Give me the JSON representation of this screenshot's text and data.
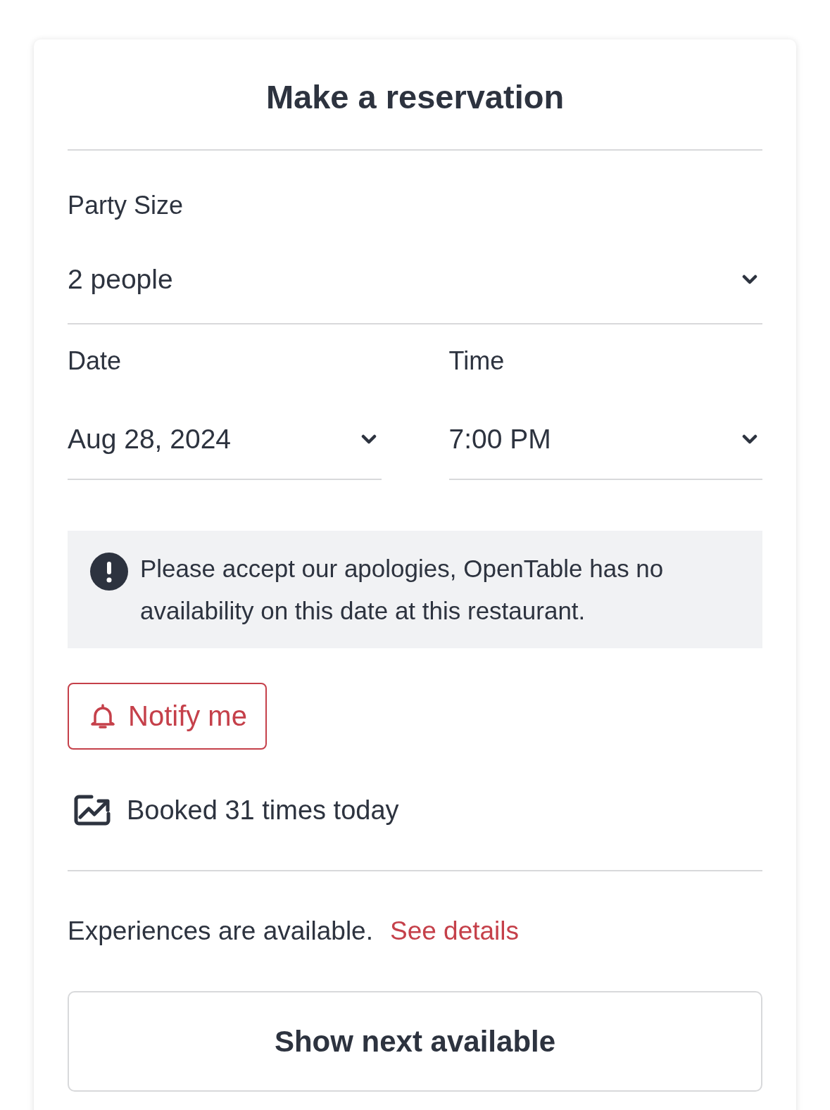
{
  "card": {
    "title": "Make a reservation"
  },
  "party_size": {
    "label": "Party Size",
    "value": "2 people"
  },
  "date": {
    "label": "Date",
    "value": "Aug 28, 2024"
  },
  "time": {
    "label": "Time",
    "value": "7:00 PM"
  },
  "alert": {
    "message": "Please accept our apologies, OpenTable has no availability on this date at this restaurant."
  },
  "notify_button": {
    "label": "Notify me"
  },
  "booking_stat": {
    "text": "Booked 31 times today"
  },
  "experiences": {
    "text": "Experiences are available.",
    "link": "See details"
  },
  "next_available_button": {
    "label": "Show next available"
  }
}
